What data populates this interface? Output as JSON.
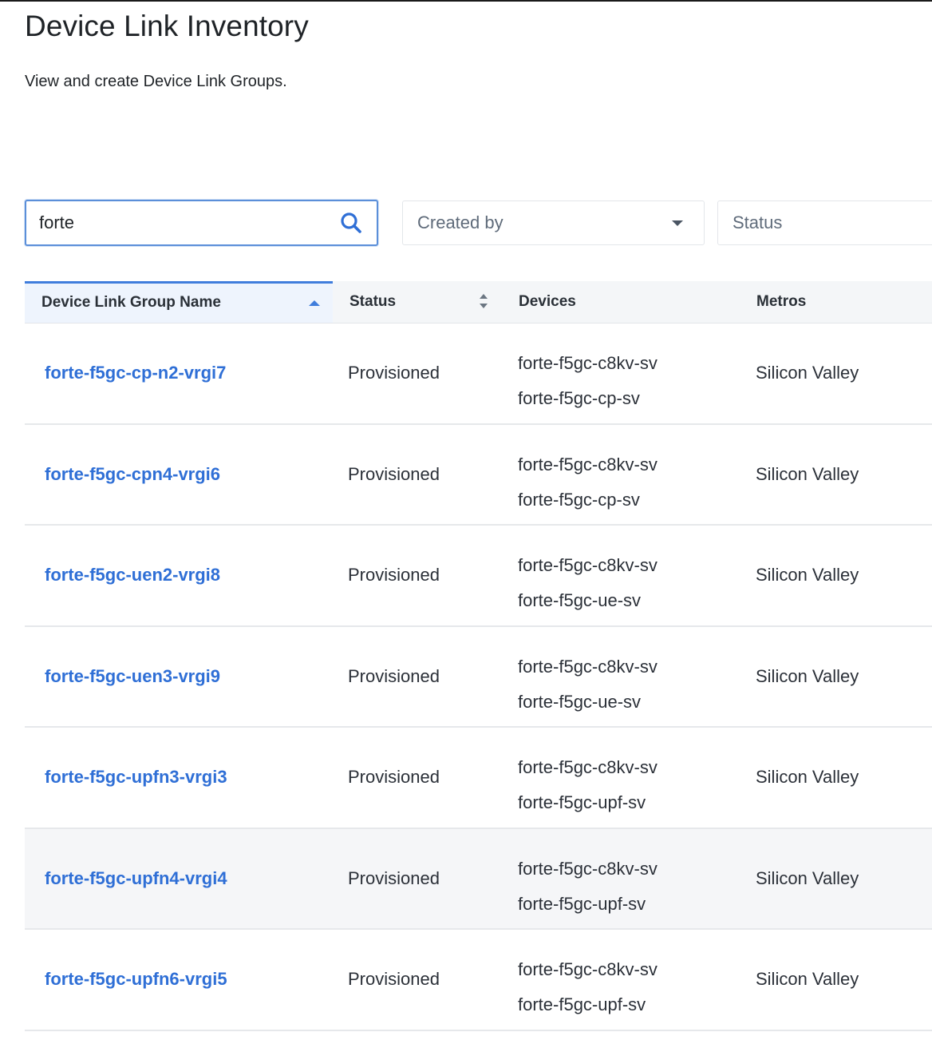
{
  "page": {
    "title": "Device Link Inventory",
    "subtitle": "View and create Device Link Groups."
  },
  "search": {
    "value": "forte",
    "icon": "search-icon"
  },
  "filters": {
    "created_by": "Created by",
    "status": "Status"
  },
  "table": {
    "columns": {
      "name": "Device Link Group Name",
      "status": "Status",
      "devices": "Devices",
      "metros": "Metros"
    },
    "sort": {
      "column": "name",
      "direction": "ascending"
    },
    "rows": [
      {
        "name": "forte-f5gc-cp-n2-vrgi7",
        "status": "Provisioned",
        "devices": [
          "forte-f5gc-c8kv-sv",
          "forte-f5gc-cp-sv"
        ],
        "metros": "Silicon Valley"
      },
      {
        "name": "forte-f5gc-cpn4-vrgi6",
        "status": "Provisioned",
        "devices": [
          "forte-f5gc-c8kv-sv",
          "forte-f5gc-cp-sv"
        ],
        "metros": "Silicon Valley"
      },
      {
        "name": "forte-f5gc-uen2-vrgi8",
        "status": "Provisioned",
        "devices": [
          "forte-f5gc-c8kv-sv",
          "forte-f5gc-ue-sv"
        ],
        "metros": "Silicon Valley"
      },
      {
        "name": "forte-f5gc-uen3-vrgi9",
        "status": "Provisioned",
        "devices": [
          "forte-f5gc-c8kv-sv",
          "forte-f5gc-ue-sv"
        ],
        "metros": "Silicon Valley"
      },
      {
        "name": "forte-f5gc-upfn3-vrgi3",
        "status": "Provisioned",
        "devices": [
          "forte-f5gc-c8kv-sv",
          "forte-f5gc-upf-sv"
        ],
        "metros": "Silicon Valley"
      },
      {
        "name": "forte-f5gc-upfn4-vrgi4",
        "status": "Provisioned",
        "devices": [
          "forte-f5gc-c8kv-sv",
          "forte-f5gc-upf-sv"
        ],
        "metros": "Silicon Valley",
        "hovered": true
      },
      {
        "name": "forte-f5gc-upfn6-vrgi5",
        "status": "Provisioned",
        "devices": [
          "forte-f5gc-c8kv-sv",
          "forte-f5gc-upf-sv"
        ],
        "metros": "Silicon Valley"
      }
    ]
  },
  "colors": {
    "link": "#2f6fd6",
    "accent": "#3f7ddc",
    "header_bg": "#f4f6f8",
    "hover_row": "#f5f6f8"
  }
}
